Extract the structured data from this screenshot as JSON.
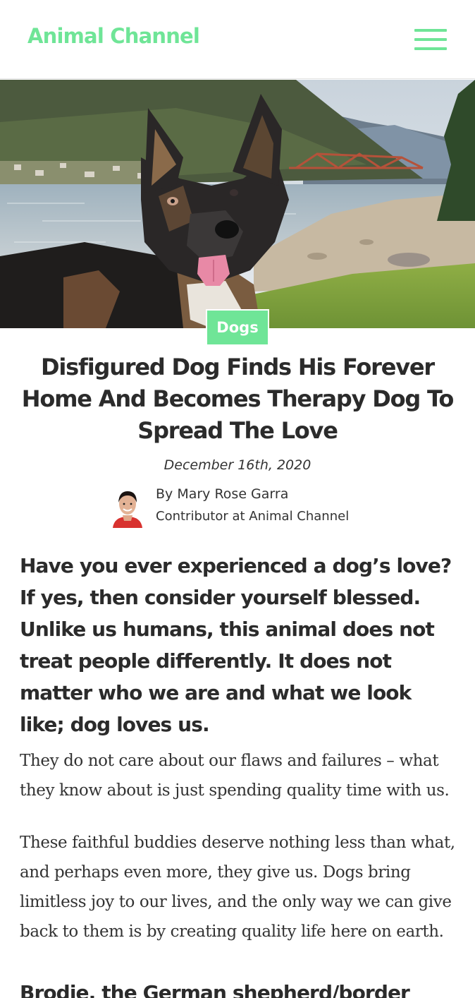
{
  "header": {
    "logo_text": "Animal Channel",
    "menu_icon": "hamburger-menu-icon",
    "accent_color": "#6fe597"
  },
  "hero": {
    "image_subject": "German shepherd dog with tongue out by a lake and red bridge"
  },
  "article": {
    "category": "Dogs",
    "title": "Disfigured Dog Finds His Forever Home And Becomes Therapy Dog To Spread The Love",
    "date": "December 16th, 2020",
    "author": {
      "name": "By Mary Rose Garra",
      "role": "Contributor at Animal Channel"
    },
    "lead": "Have you ever experienced a dog’s love? If yes, then consider yourself blessed. Unlike us humans, this animal does not treat people differently. It does not matter who we are and what we look like; dog loves us.",
    "paragraphs": [
      "They do not care about our flaws and failures – what they know about is just spending quality time with us.",
      "These faithful buddies deserve nothing less than what, and perhaps even more, they give us. Dogs bring limitless joy to our lives, and the only way we can give back to them is by creating quality life here on earth."
    ],
    "subheading": "Brodie, the German shepherd/border"
  }
}
